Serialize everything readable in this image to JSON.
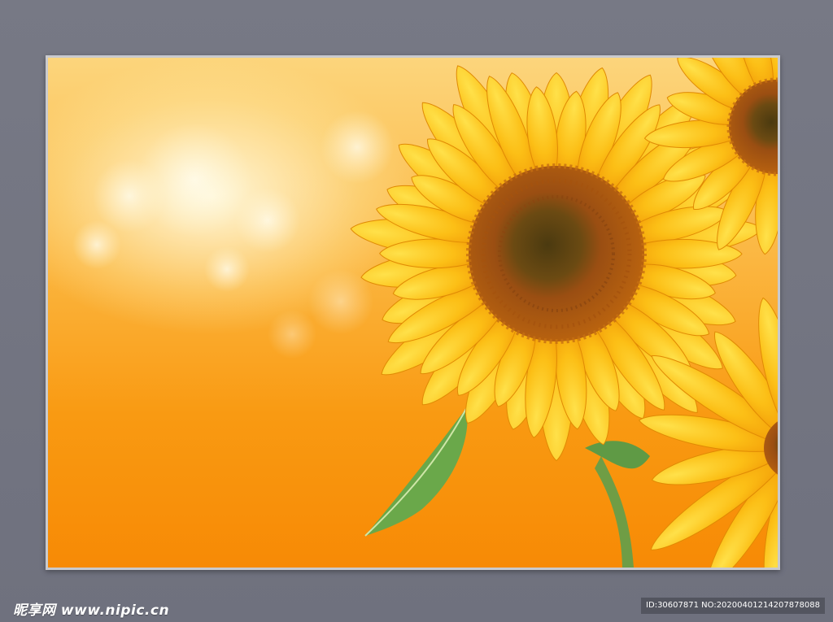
{
  "image": {
    "subject": "sunflower-photo",
    "colors": {
      "background_gray": "#74767f",
      "orange": "#f78a05",
      "yellow": "#fcc21a",
      "center_brown": "#9b4a12"
    }
  },
  "watermark": {
    "site": "昵享网 www.nipic.cn",
    "id_text": "ID:30607871 NO:20200401214207878088"
  }
}
